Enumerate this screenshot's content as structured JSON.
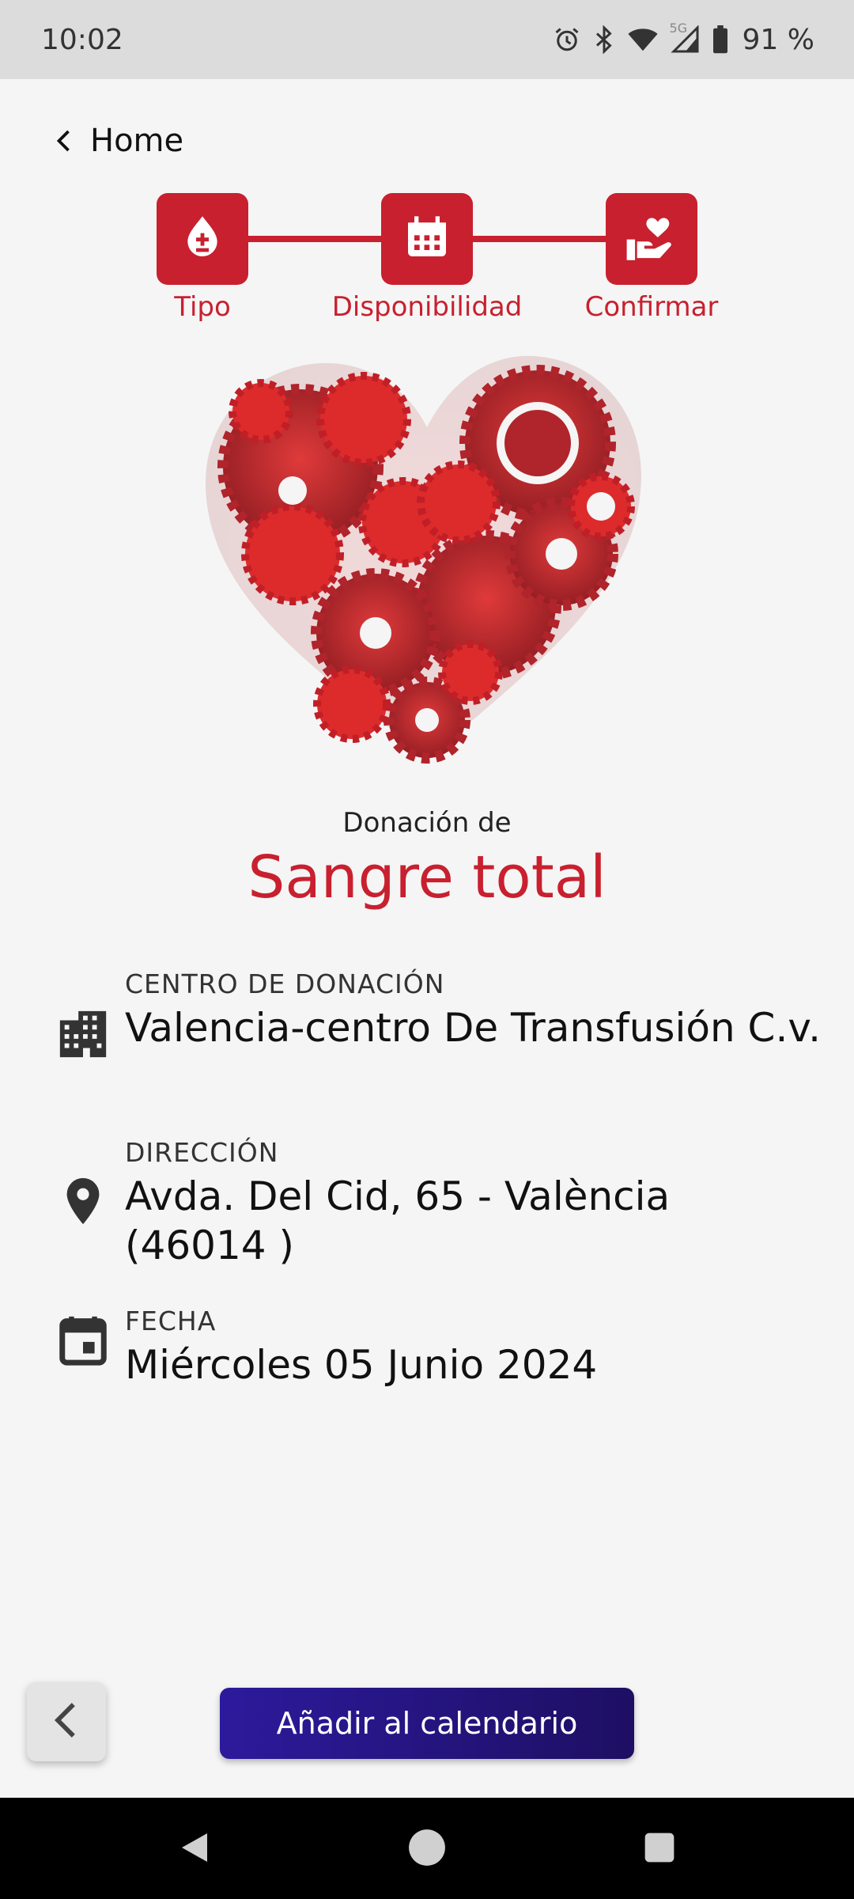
{
  "status_bar": {
    "time": "10:02",
    "network": "5G",
    "battery": "91 %",
    "icons": [
      "alarm-icon",
      "bluetooth-icon",
      "wifi-icon",
      "signal-icon",
      "battery-icon"
    ]
  },
  "header": {
    "back_label": "Home"
  },
  "stepper": {
    "accent_color": "#c8202f",
    "steps": [
      {
        "label": "Tipo",
        "icon": "blood-drop-icon"
      },
      {
        "label": "Disponibilidad",
        "icon": "calendar-icon"
      },
      {
        "label": "Confirmar",
        "icon": "heart-hand-icon"
      }
    ]
  },
  "hero": {
    "icon": "gear-heart-illustration"
  },
  "donation": {
    "subtitle": "Donación de",
    "type": "Sangre total"
  },
  "details": {
    "center_label": "CENTRO DE DONACIÓN",
    "center_value": "Valencia-centro De Transfusión C.v.",
    "address_label": "DIRECCIÓN",
    "address_value": "Avda. Del Cid, 65 - València (46014 )",
    "date_label": "FECHA",
    "date_value": "Miércoles 05 Junio 2024"
  },
  "actions": {
    "add_calendar_label": "Añadir al calendario",
    "button_color": "#2c1a9c"
  }
}
